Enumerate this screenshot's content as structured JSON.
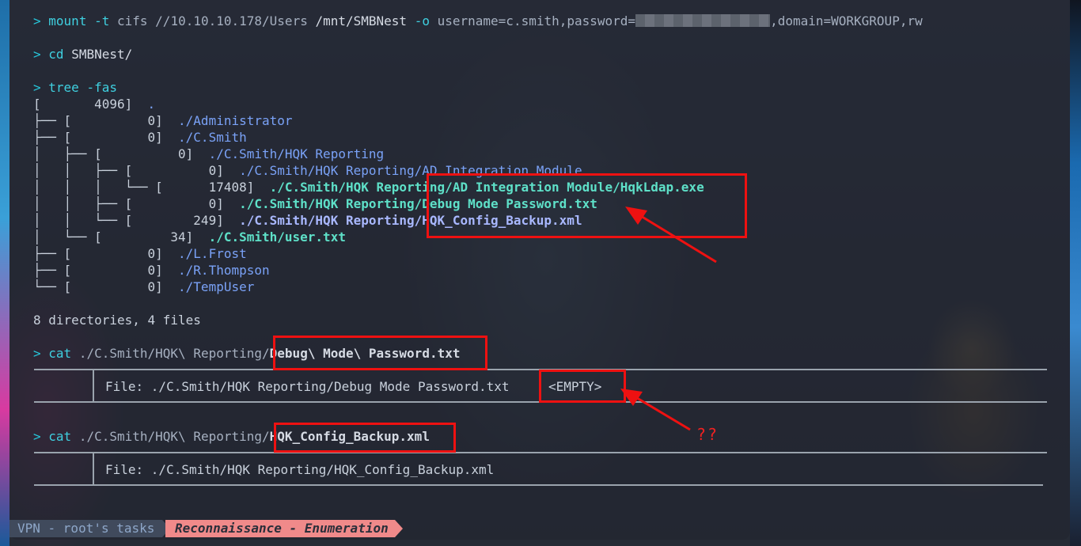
{
  "prompt_symbol": ">",
  "cmd1": {
    "name": "mount",
    "flag_t": "-t",
    "fs": "cifs",
    "share": "//10.10.10.178/Users",
    "mountpoint": "/mnt/SMBNest",
    "flag_o": "-o",
    "opts_prefix": "username=c.smith,password=",
    "opts_suffix": ",domain=WORKGROUP,rw"
  },
  "cmd2": {
    "name": "cd",
    "arg": "SMBNest/"
  },
  "cmd3": {
    "name": "tree",
    "flag": "-fas"
  },
  "tree": [
    {
      "prefix": "[",
      "size": "       4096]",
      "name": "  .",
      "kind": "root"
    },
    {
      "prefix": "├── [",
      "size": "          0]",
      "name": "  ./Administrator",
      "kind": "dir"
    },
    {
      "prefix": "├── [",
      "size": "          0]",
      "name": "  ./C.Smith",
      "kind": "dir"
    },
    {
      "prefix": "│   ├── [",
      "size": "          0]",
      "name": "  ./C.Smith/HQK Reporting",
      "kind": "dir"
    },
    {
      "prefix": "│   │   ├── [",
      "size": "          0]",
      "name": "  ./C.Smith/HQK Reporting/AD Integration Module",
      "kind": "dir"
    },
    {
      "prefix": "│   │   │   └── [",
      "size": "      17408]",
      "name": "  ./C.Smith/HQK Reporting/AD Integration Module/HqkLdap.exe",
      "kind": "file"
    },
    {
      "prefix": "│   │   ├── [",
      "size": "          0]",
      "name": "  ./C.Smith/HQK Reporting/Debug Mode Password.txt",
      "kind": "file"
    },
    {
      "prefix": "│   │   └── [",
      "size": "        249]",
      "name": "  ./C.Smith/HQK Reporting/HQK_Config_Backup.xml",
      "kind": "xml"
    },
    {
      "prefix": "│   └── [",
      "size": "         34]",
      "name": "  ./C.Smith/user.txt",
      "kind": "file"
    },
    {
      "prefix": "├── [",
      "size": "          0]",
      "name": "  ./L.Frost",
      "kind": "dir"
    },
    {
      "prefix": "├── [",
      "size": "          0]",
      "name": "  ./R.Thompson",
      "kind": "dir"
    },
    {
      "prefix": "└── [",
      "size": "          0]",
      "name": "  ./TempUser",
      "kind": "dir"
    }
  ],
  "tree_summary": "8 directories, 4 files",
  "cmd4": {
    "name": "cat",
    "path_dim": "./C.Smith/HQK\\ Reporting/",
    "path_bold": "Debug\\ Mode\\ Password.txt"
  },
  "bat1": {
    "header": "File: ./C.Smith/HQK Reporting/Debug Mode Password.txt",
    "content": "<EMPTY>"
  },
  "cmd5": {
    "name": "cat",
    "path_dim": "./C.Smith/HQK\\ Reporting/",
    "path_bold": "HQK_Config_Backup.xml"
  },
  "bat2": {
    "header": "File: ./C.Smith/HQK Reporting/HQK_Config_Backup.xml"
  },
  "annotation": "??",
  "statusbar": {
    "workspace": "VPN - root's tasks",
    "task": "Reconnaissance - Enumeration"
  },
  "colors": {
    "prompt": "#26c6da",
    "directory": "#7aa2f7",
    "file": "#5ee0c8",
    "highlight_box": "#ee1111",
    "status_task_bg": "#f08a8a"
  }
}
